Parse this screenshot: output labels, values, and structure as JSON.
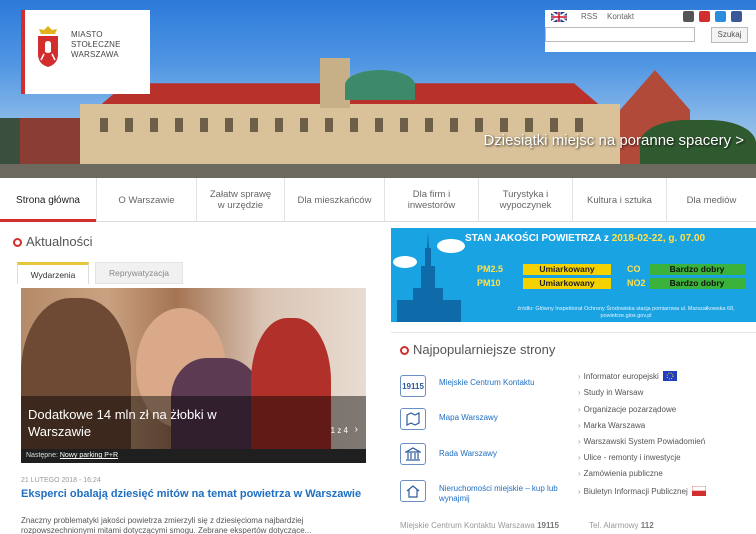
{
  "logo": {
    "line1": "MIASTO",
    "line2": "STOŁECZNE",
    "line3": "WARSZAWA"
  },
  "util": {
    "rss": "RSS",
    "contact": "Kontakt",
    "search_placeholder": "",
    "search_button": "Szukaj"
  },
  "hero": {
    "caption": "Dziesiątki miejsc na poranne spacery >"
  },
  "nav": {
    "items": [
      "Strona główna",
      "O Warszawie",
      "Załatw sprawę w urzędzie",
      "Dla mieszkańców",
      "Dla firm i inwestorów",
      "Turystyka i wypoczynek",
      "Kultura i sztuka",
      "Dla mediów"
    ]
  },
  "news": {
    "heading": "Aktualności",
    "tab_active": "Wydarzenia",
    "tab_inactive": "Reprywatyzacja",
    "slide_title": "Dodatkowe 14 mln zł na żłobki w Warszawie",
    "pager": "1 z 4",
    "next_label": "Następne:",
    "next_link": "Nowy parking P+R",
    "article_date": "21 LUTEGO 2018 - 16:24",
    "article_title": "Eksperci obalają dziesięć mitów na temat powietrza w Warszawie",
    "article_snippet": "Znaczny problematyki jakości powietrza zmierzyli się z dziesięcioma najbardziej rozpowszechnionymi mitami dotyczącymi smogu. Zebrane ekspertów dotyczące..."
  },
  "air": {
    "head": "STAN JAKOŚCI POWIETRZA z",
    "date": "2018-02-22, g. 07.00",
    "rows": [
      {
        "label": "PM2.5",
        "value": "Umiarkowany",
        "level": "mod",
        "label2": "CO",
        "value2": "Bardzo dobry",
        "level2": "good"
      },
      {
        "label": "PM10",
        "value": "Umiarkowany",
        "level": "mod",
        "label2": "NO2",
        "value2": "Bardzo dobry",
        "level2": "good"
      }
    ],
    "source": "źródło: Główny Inspektorat Ochrony Środowiska stacja pomiarowa ul. Marszałkowska 68, powietrze.gios.gov.pl"
  },
  "popular": {
    "heading": "Najpopularniejsze strony",
    "left": [
      {
        "icon": "19115",
        "label": "Miejskie Centrum Kontaktu"
      },
      {
        "icon": "map",
        "label": "Mapa Warszawy"
      },
      {
        "icon": "council",
        "label": "Rada Warszawy"
      },
      {
        "icon": "property",
        "label": "Nieruchomości miejskie – kup lub wynajmij"
      }
    ],
    "right": [
      "Informator europejski",
      "Study in Warsaw",
      "Organizacje pozarządowe",
      "Marka Warszawa",
      "Warszawski System Powiadomień",
      "Ulice - remonty i inwestycje",
      "Zamówienia publiczne",
      "Biuletyn Informacji Publicznej"
    ]
  },
  "contact": {
    "left_label": "Miejskie Centrum Kontaktu Warszawa",
    "left_number": "19115",
    "right_label": "Tel. Alarmowy",
    "right_number": "112"
  },
  "colors": {
    "accent_red": "#d22e2e",
    "link_blue": "#1f6fc3",
    "air_bg": "#1aa3e2",
    "moderate": "#f4d200",
    "good": "#3bb23b"
  }
}
